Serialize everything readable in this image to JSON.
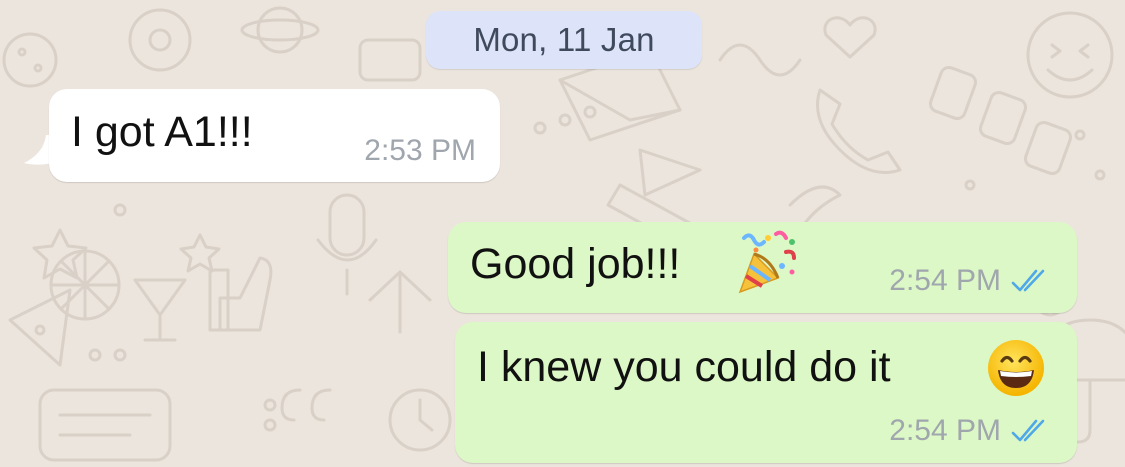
{
  "date_divider": {
    "label": "Mon, 11 Jan"
  },
  "messages": [
    {
      "direction": "incoming",
      "text": "I got A1!!!",
      "time": "2:53 PM"
    },
    {
      "direction": "outgoing",
      "text": "Good job!!!",
      "emoji_icon": "party-popper-icon",
      "time": "2:54 PM",
      "status": "read-double-check-icon"
    },
    {
      "direction": "outgoing",
      "text": "I knew you could do it",
      "emoji_icon": "grinning-face-icon",
      "time": "2:54 PM",
      "status": "read-double-check-icon"
    }
  ],
  "colors": {
    "wallpaper": "#ece5dd",
    "date_chip": "#dde3f8",
    "incoming_bubble": "#ffffff",
    "outgoing_bubble": "#dcf8c6",
    "read_ticks": "#4fa8e8",
    "timestamp": "#a0a6ad"
  }
}
